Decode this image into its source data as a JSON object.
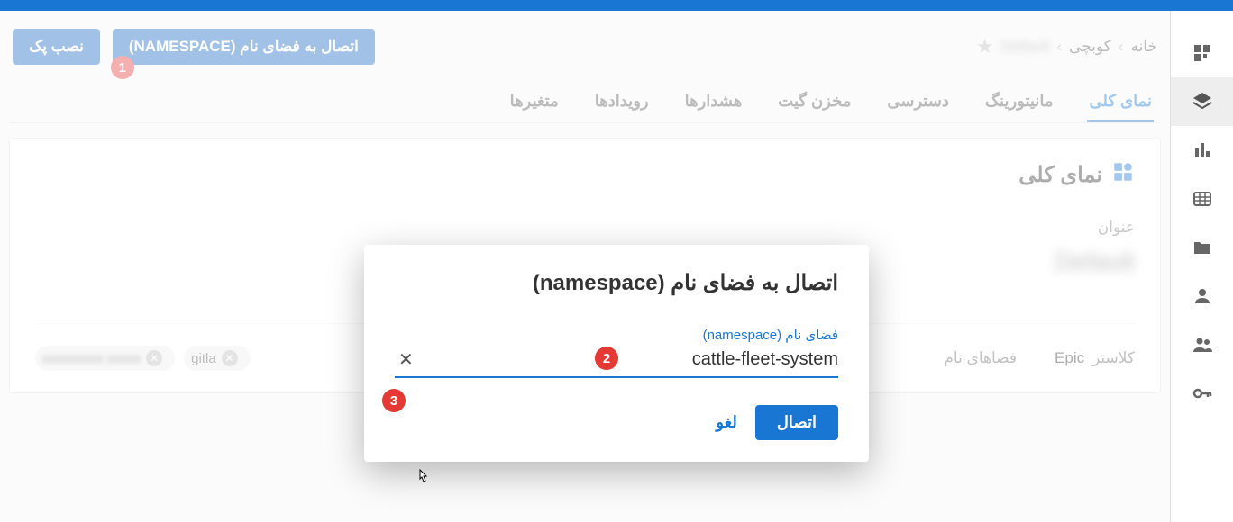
{
  "breadcrumb": {
    "home": "خانه",
    "section": "کوبچی",
    "item": "Default"
  },
  "actions": {
    "connect_namespace": "اتصال به فضای نام (NAMESPACE)",
    "install_pack": "نصب پک"
  },
  "tabs": {
    "overview": "نمای کلی",
    "monitoring": "مانیتورینگ",
    "access": "دسترسی",
    "git_repo": "مخزن گیت",
    "alerts": "هشدارها",
    "events": "رویدادها",
    "variables": "متغیرها"
  },
  "panel": {
    "title": "نمای کلی",
    "title_label": "عنوان",
    "title_value": "Default",
    "cluster_label": "کلاستر",
    "cluster_value": "Epic",
    "namespaces_label": "فضاهای نام",
    "chips": {
      "blurred": "xxxxxxxxx xxxxx",
      "git": "gitla"
    }
  },
  "modal": {
    "title": "اتصال به فضای نام (namespace)",
    "field_label": "فضای نام (namespace)",
    "field_value": "cattle-fleet-system",
    "connect": "اتصال",
    "cancel": "لغو"
  },
  "steps": {
    "s1": "1",
    "s2": "2",
    "s3": "3"
  }
}
